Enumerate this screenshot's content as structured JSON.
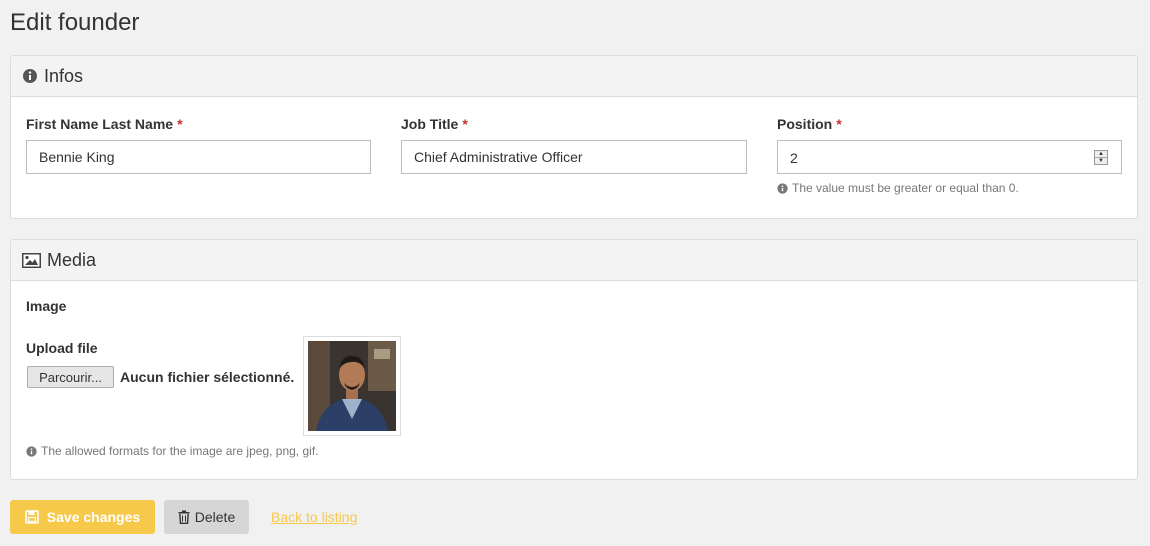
{
  "page": {
    "title": "Edit founder"
  },
  "infos": {
    "heading": "Infos",
    "heading_icon": "info-circle-icon",
    "fields": {
      "name": {
        "label": "First Name Last Name",
        "required_mark": "*",
        "value": "Bennie King"
      },
      "job": {
        "label": "Job Title",
        "required_mark": "*",
        "value": "Chief Administrative Officer"
      },
      "position": {
        "label": "Position",
        "required_mark": "*",
        "value": "2",
        "help": "The value must be greater or equal than 0."
      }
    }
  },
  "media": {
    "heading": "Media",
    "heading_icon": "image-icon",
    "image_label": "Image",
    "upload_label": "Upload file",
    "browse_label": "Parcourir...",
    "no_file_text": "Aucun fichier sélectionné.",
    "help": "The allowed formats for the image are jpeg, png, gif."
  },
  "actions": {
    "save_label": "Save changes",
    "delete_label": "Delete",
    "back_label": "Back to listing"
  },
  "colors": {
    "accent": "#f7c94a",
    "required": "#c9302c",
    "panel_heading_bg": "#f3f3f3"
  }
}
